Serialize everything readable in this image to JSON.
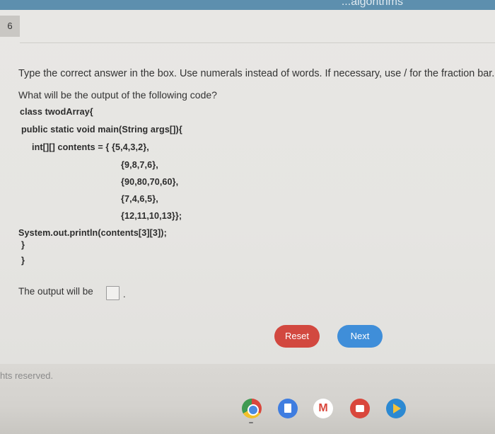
{
  "top_strip": {
    "text": "...algorithms"
  },
  "question": {
    "number": "6",
    "instruction": "Type the correct answer in the box. Use numerals instead of words. If necessary, use / for the fraction bar.",
    "prompt": "What will be the output of the following code?",
    "code_lines": [
      "class twodArray{",
      "public static void main(String args[]){",
      "int[][] contents = { {5,4,3,2},",
      "{9,8,7,6},",
      "{90,80,70,60},",
      "{7,4,6,5},",
      "{12,11,10,13}};",
      "System.out.println(contents[3][3]);",
      "}",
      "}"
    ],
    "answer_label": "The output will be",
    "answer_value": "",
    "answer_suffix": "."
  },
  "buttons": {
    "reset": "Reset",
    "next": "Next"
  },
  "footer": {
    "copyright": "hts reserved."
  },
  "taskbar": {
    "gmail_glyph": "M"
  },
  "colors": {
    "reset": "#d2483f",
    "next": "#3f8ed9"
  }
}
